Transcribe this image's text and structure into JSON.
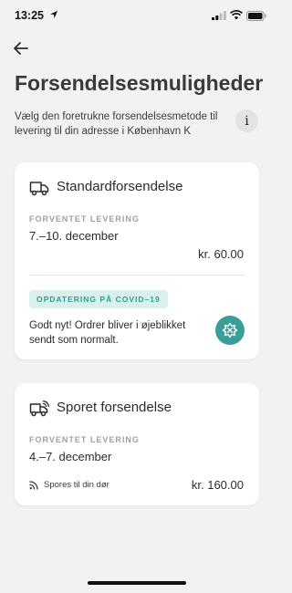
{
  "status_bar": {
    "time": "13:25"
  },
  "header": {
    "title": "Forsendelsesmuligheder",
    "subtitle": "Vælg den foretrukne forsendelsesmetode til levering til din adresse i København K",
    "info_label": "i"
  },
  "options": [
    {
      "title": "Standardforsendelse",
      "delivery_label": "FORVENTET LEVERING",
      "delivery_dates": "7.–10. december",
      "price": "kr. 60.00",
      "notice": {
        "badge": "OPDATERING PÅ COVID–19",
        "text": "Godt nyt! Ordrer bliver i øjeblikket sendt som normalt."
      }
    },
    {
      "title": "Sporet forsendelse",
      "delivery_label": "FORVENTET LEVERING",
      "delivery_dates": "4.–7. december",
      "tracking_text": "Spores til din dør",
      "price": "kr. 160.00"
    }
  ],
  "colors": {
    "background": "#f2f2f2",
    "card": "#ffffff",
    "accent_teal": "#3a9d98",
    "badge_bg": "#d9f0ee",
    "muted_label": "#a0a0a0"
  },
  "icons": {
    "back": "arrow-left-icon",
    "standard": "truck-icon",
    "tracked": "tracked-truck-icon",
    "notice": "covid-shield-icon",
    "tracking": "signal-waves-icon"
  }
}
